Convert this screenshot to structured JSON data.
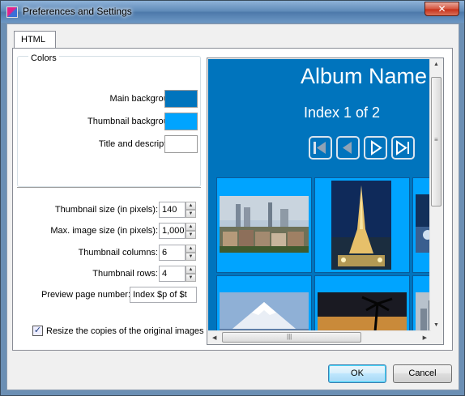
{
  "window": {
    "title": "Preferences and Settings",
    "close_glyph": "✕"
  },
  "tabs": [
    {
      "label": "HTML",
      "selected": true
    }
  ],
  "colors": {
    "legend": "Colors",
    "main_background": {
      "label": "Main background:",
      "color": "#0074bd"
    },
    "thumbnail_background": {
      "label": "Thumbnail background:",
      "color": "#00a4ff"
    },
    "title_and_description": {
      "label": "Title and description:",
      "color": "#ffffff"
    }
  },
  "settings": {
    "thumbnail_size": {
      "label": "Thumbnail size (in pixels):",
      "value": "140"
    },
    "max_image_size": {
      "label": "Max. image size (in pixels):",
      "value": "1,000"
    },
    "thumbnail_columns": {
      "label": "Thumbnail columns:",
      "value": "6"
    },
    "thumbnail_rows": {
      "label": "Thumbnail rows:",
      "value": "4"
    },
    "preview_page_number": {
      "label": "Preview page number:",
      "value": "Index $p of $t"
    },
    "resize_copies": {
      "label": "Resize the copies of the original images",
      "checked": true
    }
  },
  "preview": {
    "album_name": "Album Name",
    "index_text": "Index 1 of 2",
    "nav_icons": [
      "first-page-icon",
      "previous-page-icon",
      "next-page-icon",
      "last-page-icon"
    ],
    "scroll_glyphs": {
      "up": "▲",
      "down": "▼",
      "left": "◀",
      "right": "▶",
      "grip_v": "≡",
      "grip_h": "|||"
    }
  },
  "buttons": {
    "ok": "OK",
    "cancel": "Cancel"
  }
}
